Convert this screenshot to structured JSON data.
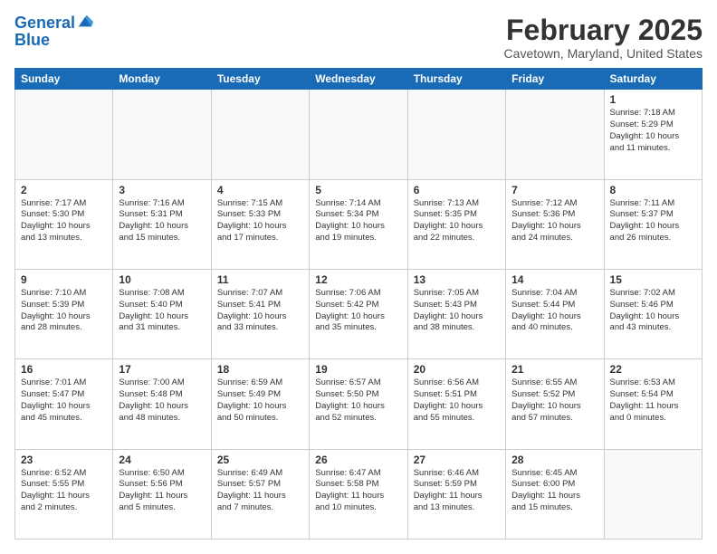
{
  "header": {
    "logo_line1": "General",
    "logo_line2": "Blue",
    "month_title": "February 2025",
    "location": "Cavetown, Maryland, United States"
  },
  "weekdays": [
    "Sunday",
    "Monday",
    "Tuesday",
    "Wednesday",
    "Thursday",
    "Friday",
    "Saturday"
  ],
  "weeks": [
    [
      {
        "day": "",
        "info": ""
      },
      {
        "day": "",
        "info": ""
      },
      {
        "day": "",
        "info": ""
      },
      {
        "day": "",
        "info": ""
      },
      {
        "day": "",
        "info": ""
      },
      {
        "day": "",
        "info": ""
      },
      {
        "day": "1",
        "info": "Sunrise: 7:18 AM\nSunset: 5:29 PM\nDaylight: 10 hours\nand 11 minutes."
      }
    ],
    [
      {
        "day": "2",
        "info": "Sunrise: 7:17 AM\nSunset: 5:30 PM\nDaylight: 10 hours\nand 13 minutes."
      },
      {
        "day": "3",
        "info": "Sunrise: 7:16 AM\nSunset: 5:31 PM\nDaylight: 10 hours\nand 15 minutes."
      },
      {
        "day": "4",
        "info": "Sunrise: 7:15 AM\nSunset: 5:33 PM\nDaylight: 10 hours\nand 17 minutes."
      },
      {
        "day": "5",
        "info": "Sunrise: 7:14 AM\nSunset: 5:34 PM\nDaylight: 10 hours\nand 19 minutes."
      },
      {
        "day": "6",
        "info": "Sunrise: 7:13 AM\nSunset: 5:35 PM\nDaylight: 10 hours\nand 22 minutes."
      },
      {
        "day": "7",
        "info": "Sunrise: 7:12 AM\nSunset: 5:36 PM\nDaylight: 10 hours\nand 24 minutes."
      },
      {
        "day": "8",
        "info": "Sunrise: 7:11 AM\nSunset: 5:37 PM\nDaylight: 10 hours\nand 26 minutes."
      }
    ],
    [
      {
        "day": "9",
        "info": "Sunrise: 7:10 AM\nSunset: 5:39 PM\nDaylight: 10 hours\nand 28 minutes."
      },
      {
        "day": "10",
        "info": "Sunrise: 7:08 AM\nSunset: 5:40 PM\nDaylight: 10 hours\nand 31 minutes."
      },
      {
        "day": "11",
        "info": "Sunrise: 7:07 AM\nSunset: 5:41 PM\nDaylight: 10 hours\nand 33 minutes."
      },
      {
        "day": "12",
        "info": "Sunrise: 7:06 AM\nSunset: 5:42 PM\nDaylight: 10 hours\nand 35 minutes."
      },
      {
        "day": "13",
        "info": "Sunrise: 7:05 AM\nSunset: 5:43 PM\nDaylight: 10 hours\nand 38 minutes."
      },
      {
        "day": "14",
        "info": "Sunrise: 7:04 AM\nSunset: 5:44 PM\nDaylight: 10 hours\nand 40 minutes."
      },
      {
        "day": "15",
        "info": "Sunrise: 7:02 AM\nSunset: 5:46 PM\nDaylight: 10 hours\nand 43 minutes."
      }
    ],
    [
      {
        "day": "16",
        "info": "Sunrise: 7:01 AM\nSunset: 5:47 PM\nDaylight: 10 hours\nand 45 minutes."
      },
      {
        "day": "17",
        "info": "Sunrise: 7:00 AM\nSunset: 5:48 PM\nDaylight: 10 hours\nand 48 minutes."
      },
      {
        "day": "18",
        "info": "Sunrise: 6:59 AM\nSunset: 5:49 PM\nDaylight: 10 hours\nand 50 minutes."
      },
      {
        "day": "19",
        "info": "Sunrise: 6:57 AM\nSunset: 5:50 PM\nDaylight: 10 hours\nand 52 minutes."
      },
      {
        "day": "20",
        "info": "Sunrise: 6:56 AM\nSunset: 5:51 PM\nDaylight: 10 hours\nand 55 minutes."
      },
      {
        "day": "21",
        "info": "Sunrise: 6:55 AM\nSunset: 5:52 PM\nDaylight: 10 hours\nand 57 minutes."
      },
      {
        "day": "22",
        "info": "Sunrise: 6:53 AM\nSunset: 5:54 PM\nDaylight: 11 hours\nand 0 minutes."
      }
    ],
    [
      {
        "day": "23",
        "info": "Sunrise: 6:52 AM\nSunset: 5:55 PM\nDaylight: 11 hours\nand 2 minutes."
      },
      {
        "day": "24",
        "info": "Sunrise: 6:50 AM\nSunset: 5:56 PM\nDaylight: 11 hours\nand 5 minutes."
      },
      {
        "day": "25",
        "info": "Sunrise: 6:49 AM\nSunset: 5:57 PM\nDaylight: 11 hours\nand 7 minutes."
      },
      {
        "day": "26",
        "info": "Sunrise: 6:47 AM\nSunset: 5:58 PM\nDaylight: 11 hours\nand 10 minutes."
      },
      {
        "day": "27",
        "info": "Sunrise: 6:46 AM\nSunset: 5:59 PM\nDaylight: 11 hours\nand 13 minutes."
      },
      {
        "day": "28",
        "info": "Sunrise: 6:45 AM\nSunset: 6:00 PM\nDaylight: 11 hours\nand 15 minutes."
      },
      {
        "day": "",
        "info": ""
      }
    ]
  ]
}
